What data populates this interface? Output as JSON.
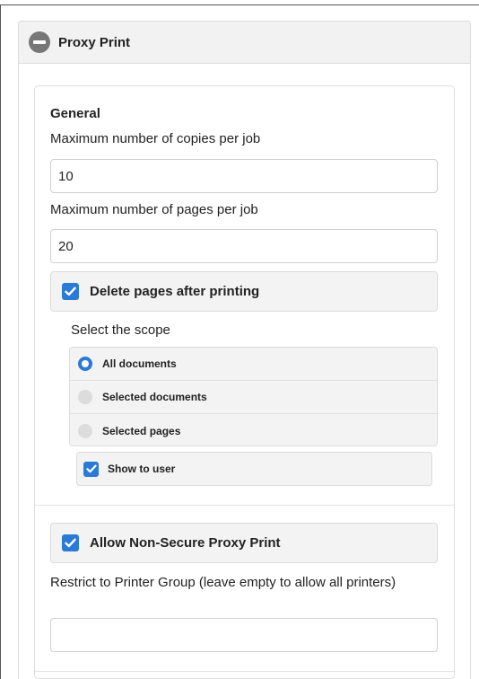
{
  "panel": {
    "title": "Proxy Print",
    "icon": "collapse-minus-icon"
  },
  "general": {
    "title": "General",
    "max_copies_label": "Maximum number of copies per job",
    "max_copies_value": "10",
    "max_pages_label": "Maximum number of pages per job",
    "max_pages_value": "20",
    "delete_pages_label": "Delete pages after printing",
    "delete_pages_checked": true,
    "scope_label": "Select the scope",
    "scope_options": [
      {
        "label": "All documents",
        "selected": true
      },
      {
        "label": "Selected documents",
        "selected": false
      },
      {
        "label": "Selected pages",
        "selected": false
      }
    ],
    "show_to_user_label": "Show to user",
    "show_to_user_checked": true
  },
  "non_secure": {
    "allow_label": "Allow Non-Secure Proxy Print",
    "allow_checked": true,
    "restrict_label": "Restrict to Printer Group (leave empty to allow all printers)",
    "restrict_value": ""
  },
  "colors": {
    "accent": "#2a7ad6",
    "bar_bg": "#f3f3f3"
  }
}
